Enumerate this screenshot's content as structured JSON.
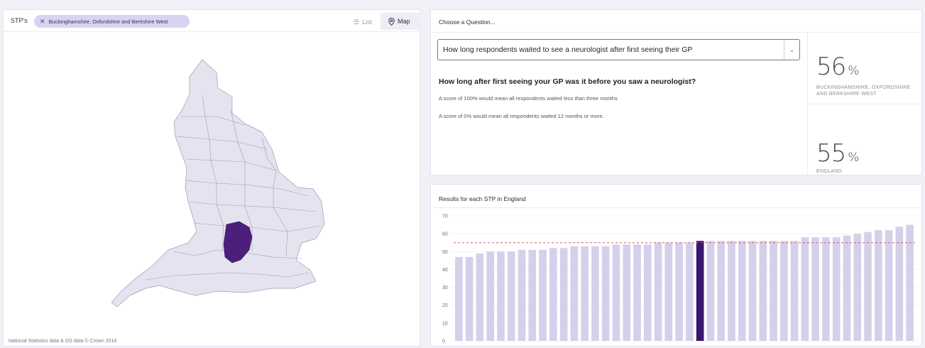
{
  "map_panel": {
    "stp_label": "STP's",
    "selected_chip": "Buckinghamshire, Oxfordshire and Berkshire West",
    "list_label": "List",
    "map_label": "Map",
    "footer": "National Statistics data & OS data © Crown 2018",
    "region_color": "#e6e3f0",
    "selected_color": "#4b1f7a"
  },
  "question_panel": {
    "title": "Choose a Question...",
    "selected_question": "How long respondents waited to see a neurologist after first seeing their GP",
    "heading": "How long after first seeing your GP was it before you saw a neurologist?",
    "desc1": "A score of 100% would mean all respondents waited less than three months",
    "desc2": "A score of 0% would mean all respondents waited 12 months or more.",
    "stats": [
      {
        "value": "56",
        "unit": "%",
        "name": "BUCKINGHAMSHIRE, OXFORDSHIRE AND BERKSHIRE WEST"
      },
      {
        "value": "55",
        "unit": "%",
        "name": "ENGLAND"
      }
    ]
  },
  "chart_panel": {
    "title": "Results for each STP in England"
  },
  "chart_data": {
    "type": "bar",
    "values": [
      47,
      47,
      49,
      50,
      50,
      50,
      51,
      51,
      51,
      52,
      52,
      53,
      53,
      53,
      53,
      54,
      54,
      54,
      54,
      55,
      55,
      55,
      55,
      56,
      56,
      56,
      56,
      56,
      56,
      56,
      56,
      56,
      56,
      58,
      58,
      58,
      58,
      59,
      60,
      61,
      62,
      62,
      64,
      65
    ],
    "highlight_index": 23,
    "reference_line": 55,
    "ylim": [
      0,
      70
    ],
    "yticks": [
      "0",
      "10",
      "20",
      "30",
      "40",
      "50",
      "60",
      "70"
    ],
    "bar_color": "#d5d0ea",
    "highlight_color": "#3b1670",
    "reference_color": "#e0566a"
  }
}
